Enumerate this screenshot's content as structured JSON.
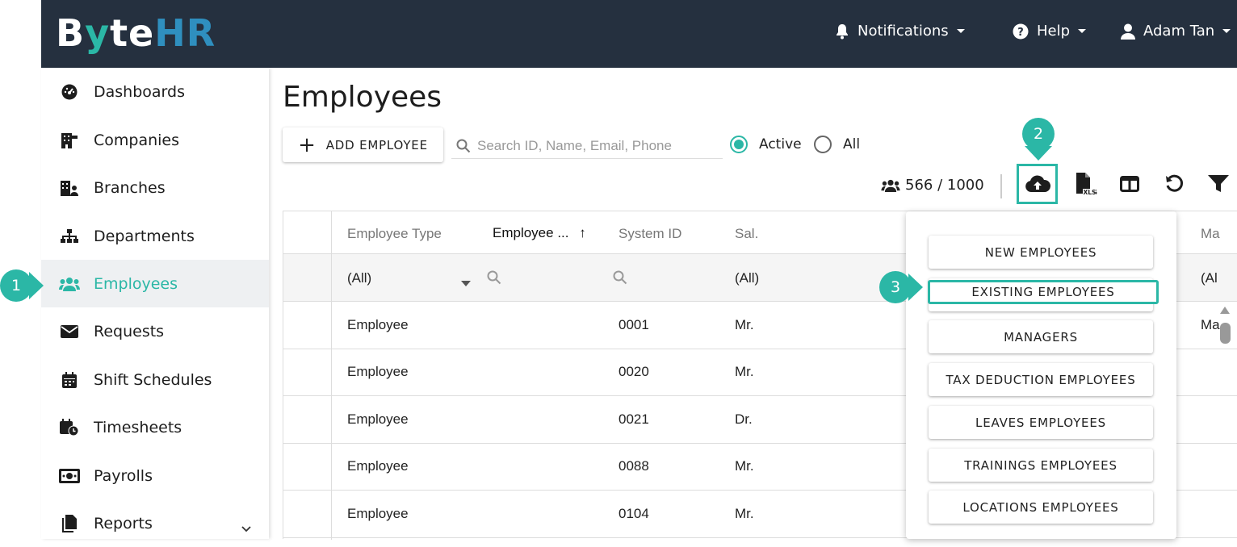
{
  "app": {
    "logo_parts": [
      "B",
      "y",
      "te",
      "HR"
    ]
  },
  "topbar": {
    "notifications_label": "Notifications",
    "help_label": "Help",
    "user_label": "Adam Tan"
  },
  "sidebar": {
    "items": [
      {
        "label": "Dashboards",
        "icon": "dashboard-icon"
      },
      {
        "label": "Companies",
        "icon": "building-icon"
      },
      {
        "label": "Branches",
        "icon": "branch-icon"
      },
      {
        "label": "Departments",
        "icon": "sitemap-icon"
      },
      {
        "label": "Employees",
        "icon": "users-icon",
        "active": true
      },
      {
        "label": "Requests",
        "icon": "envelope-icon"
      },
      {
        "label": "Shift Schedules",
        "icon": "calendar-icon"
      },
      {
        "label": "Timesheets",
        "icon": "calendar-clock-icon"
      },
      {
        "label": "Payrolls",
        "icon": "money-icon"
      },
      {
        "label": "Reports",
        "icon": "file-icon"
      }
    ]
  },
  "main": {
    "title": "Employees",
    "add_button_label": "ADD EMPLOYEE",
    "search_placeholder": "Search ID, Name, Email, Phone",
    "filter_active_label": "Active",
    "filter_all_label": "All",
    "count_text": "566 / 1000",
    "accent_color": "#2bb7a6"
  },
  "grid": {
    "headers": [
      "Employee Type",
      "Employee ...",
      "System ID",
      "Sal.",
      "Ma"
    ],
    "filter_row": {
      "employee_type": "(All)",
      "salutation": "(All)",
      "last": "(Al"
    },
    "rows": [
      {
        "type": "Employee",
        "system_id": "0001",
        "sal": "Mr.",
        "extra": "Ma"
      },
      {
        "type": "Employee",
        "system_id": "0020",
        "sal": "Mr.",
        "extra": ""
      },
      {
        "type": "Employee",
        "system_id": "0021",
        "sal": "Dr.",
        "extra": ""
      },
      {
        "type": "Employee",
        "system_id": "0088",
        "sal": "Mr.",
        "extra": ""
      },
      {
        "type": "Employee",
        "system_id": "0104",
        "sal": "Mr.",
        "extra": ""
      }
    ]
  },
  "import_menu": {
    "items": [
      "NEW EMPLOYEES",
      "EXISTING EMPLOYEES",
      "MANAGERS",
      "TAX DEDUCTION EMPLOYEES",
      "LEAVES EMPLOYEES",
      "TRAININGS EMPLOYEES",
      "LOCATIONS EMPLOYEES"
    ]
  },
  "callouts": [
    "1",
    "2",
    "3"
  ]
}
